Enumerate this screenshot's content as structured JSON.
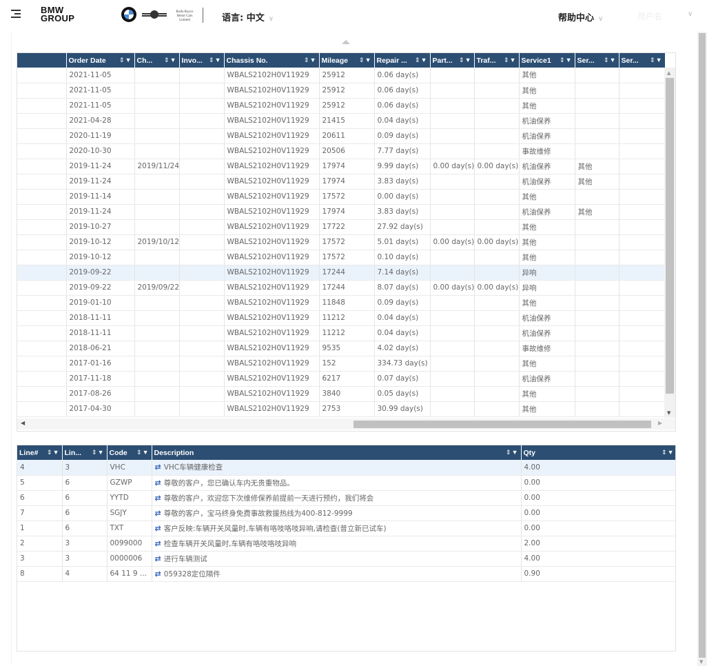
{
  "header": {
    "brand_line1": "BMW",
    "brand_line2": "GROUP",
    "rr_logo_text": "Rolls-Royce Motor Cars Limited",
    "language_label": "语言: 中文",
    "help_label": "帮助中心",
    "user_label": "用户名"
  },
  "icons": {
    "menu": "menu-icon",
    "sort": "⇕",
    "filter": "filter-icon",
    "swap": "⇄"
  },
  "colors": {
    "header_bg": "#2c4e73",
    "selected_row": "#eaf3fc",
    "swap_icon": "#2f5fb8"
  },
  "orders": {
    "columns": [
      "",
      "Order Date",
      "Ch...",
      "Invo...",
      "Chassis No.",
      "Mileage",
      "Repair ...",
      "Part...",
      "Traf...",
      "Service1",
      "Ser...",
      "Ser..."
    ],
    "rows": [
      {
        "order_date": "2021-11-05",
        "ch": "",
        "invo": "",
        "chassis": "WBALS2102H0V11929",
        "mileage": "25912",
        "repair": "0.06 day(s)",
        "part": "",
        "traf": "",
        "service1": "其他",
        "ser2": "",
        "ser3": ""
      },
      {
        "order_date": "2021-11-05",
        "ch": "",
        "invo": "",
        "chassis": "WBALS2102H0V11929",
        "mileage": "25912",
        "repair": "0.06 day(s)",
        "part": "",
        "traf": "",
        "service1": "其他",
        "ser2": "",
        "ser3": ""
      },
      {
        "order_date": "2021-11-05",
        "ch": "",
        "invo": "",
        "chassis": "WBALS2102H0V11929",
        "mileage": "25912",
        "repair": "0.06 day(s)",
        "part": "",
        "traf": "",
        "service1": "其他",
        "ser2": "",
        "ser3": ""
      },
      {
        "order_date": "2021-04-28",
        "ch": "",
        "invo": "",
        "chassis": "WBALS2102H0V11929",
        "mileage": "21415",
        "repair": "0.04 day(s)",
        "part": "",
        "traf": "",
        "service1": "机油保养",
        "ser2": "",
        "ser3": ""
      },
      {
        "order_date": "2020-11-19",
        "ch": "",
        "invo": "",
        "chassis": "WBALS2102H0V11929",
        "mileage": "20611",
        "repair": "0.09 day(s)",
        "part": "",
        "traf": "",
        "service1": "机油保养",
        "ser2": "",
        "ser3": ""
      },
      {
        "order_date": "2020-10-30",
        "ch": "",
        "invo": "",
        "chassis": "WBALS2102H0V11929",
        "mileage": "20506",
        "repair": "7.77 day(s)",
        "part": "",
        "traf": "",
        "service1": "事故维修",
        "ser2": "",
        "ser3": ""
      },
      {
        "order_date": "2019-11-24",
        "ch": "2019/11/24",
        "invo": "",
        "chassis": "WBALS2102H0V11929",
        "mileage": "17974",
        "repair": "9.99 day(s)",
        "part": "0.00 day(s)",
        "traf": "0.00 day(s)",
        "service1": "机油保养",
        "ser2": "其他",
        "ser3": ""
      },
      {
        "order_date": "2019-11-24",
        "ch": "",
        "invo": "",
        "chassis": "WBALS2102H0V11929",
        "mileage": "17974",
        "repair": "3.83 day(s)",
        "part": "",
        "traf": "",
        "service1": "机油保养",
        "ser2": "其他",
        "ser3": ""
      },
      {
        "order_date": "2019-11-14",
        "ch": "",
        "invo": "",
        "chassis": "WBALS2102H0V11929",
        "mileage": "17572",
        "repair": "0.00 day(s)",
        "part": "",
        "traf": "",
        "service1": "其他",
        "ser2": "",
        "ser3": ""
      },
      {
        "order_date": "2019-11-24",
        "ch": "",
        "invo": "",
        "chassis": "WBALS2102H0V11929",
        "mileage": "17974",
        "repair": "3.83 day(s)",
        "part": "",
        "traf": "",
        "service1": "机油保养",
        "ser2": "其他",
        "ser3": ""
      },
      {
        "order_date": "2019-10-27",
        "ch": "",
        "invo": "",
        "chassis": "WBALS2102H0V11929",
        "mileage": "17722",
        "repair": "27.92 day(s)",
        "part": "",
        "traf": "",
        "service1": "其他",
        "ser2": "",
        "ser3": ""
      },
      {
        "order_date": "2019-10-12",
        "ch": "2019/10/12",
        "invo": "",
        "chassis": "WBALS2102H0V11929",
        "mileage": "17572",
        "repair": "5.01 day(s)",
        "part": "0.00 day(s)",
        "traf": "0.00 day(s)",
        "service1": "其他",
        "ser2": "",
        "ser3": ""
      },
      {
        "order_date": "2019-10-12",
        "ch": "",
        "invo": "",
        "chassis": "WBALS2102H0V11929",
        "mileage": "17572",
        "repair": "0.10 day(s)",
        "part": "",
        "traf": "",
        "service1": "其他",
        "ser2": "",
        "ser3": ""
      },
      {
        "order_date": "2019-09-22",
        "ch": "",
        "invo": "",
        "chassis": "WBALS2102H0V11929",
        "mileage": "17244",
        "repair": "7.14 day(s)",
        "part": "",
        "traf": "",
        "service1": "异响",
        "ser2": "",
        "ser3": "",
        "selected": true
      },
      {
        "order_date": "2019-09-22",
        "ch": "2019/09/22",
        "invo": "",
        "chassis": "WBALS2102H0V11929",
        "mileage": "17244",
        "repair": "8.07 day(s)",
        "part": "0.00 day(s)",
        "traf": "0.00 day(s)",
        "service1": "异响",
        "ser2": "",
        "ser3": ""
      },
      {
        "order_date": "2019-01-10",
        "ch": "",
        "invo": "",
        "chassis": "WBALS2102H0V11929",
        "mileage": "11848",
        "repair": "0.09 day(s)",
        "part": "",
        "traf": "",
        "service1": "其他",
        "ser2": "",
        "ser3": ""
      },
      {
        "order_date": "2018-11-11",
        "ch": "",
        "invo": "",
        "chassis": "WBALS2102H0V11929",
        "mileage": "11212",
        "repair": "0.04 day(s)",
        "part": "",
        "traf": "",
        "service1": "机油保养",
        "ser2": "",
        "ser3": ""
      },
      {
        "order_date": "2018-11-11",
        "ch": "",
        "invo": "",
        "chassis": "WBALS2102H0V11929",
        "mileage": "11212",
        "repair": "0.04 day(s)",
        "part": "",
        "traf": "",
        "service1": "机油保养",
        "ser2": "",
        "ser3": ""
      },
      {
        "order_date": "2018-06-21",
        "ch": "",
        "invo": "",
        "chassis": "WBALS2102H0V11929",
        "mileage": "9535",
        "repair": "4.02 day(s)",
        "part": "",
        "traf": "",
        "service1": "事故维修",
        "ser2": "",
        "ser3": ""
      },
      {
        "order_date": "2017-01-16",
        "ch": "",
        "invo": "",
        "chassis": "WBALS2102H0V11929",
        "mileage": "152",
        "repair": "334.73 day(s)",
        "part": "",
        "traf": "",
        "service1": "其他",
        "ser2": "",
        "ser3": ""
      },
      {
        "order_date": "2017-11-18",
        "ch": "",
        "invo": "",
        "chassis": "WBALS2102H0V11929",
        "mileage": "6217",
        "repair": "0.07 day(s)",
        "part": "",
        "traf": "",
        "service1": "机油保养",
        "ser2": "",
        "ser3": ""
      },
      {
        "order_date": "2017-08-26",
        "ch": "",
        "invo": "",
        "chassis": "WBALS2102H0V11929",
        "mileage": "3840",
        "repair": "0.05 day(s)",
        "part": "",
        "traf": "",
        "service1": "其他",
        "ser2": "",
        "ser3": ""
      },
      {
        "order_date": "2017-04-30",
        "ch": "",
        "invo": "",
        "chassis": "WBALS2102H0V11929",
        "mileage": "2753",
        "repair": "30.99 day(s)",
        "part": "",
        "traf": "",
        "service1": "其他",
        "ser2": "",
        "ser3": ""
      }
    ]
  },
  "lines": {
    "columns": [
      "Line#",
      "Lin...",
      "Code",
      "Description",
      "Qty"
    ],
    "rows": [
      {
        "line": "4",
        "lin": "3",
        "code": "VHC",
        "description": "VHC车辆健康检查",
        "qty": "4.00",
        "selected": true
      },
      {
        "line": "5",
        "lin": "6",
        "code": "GZWP",
        "description": "尊敬的客户，您已确认车内无贵重物品。",
        "qty": "0.00"
      },
      {
        "line": "6",
        "lin": "6",
        "code": "YYTD",
        "description": "尊敬的客户，欢迎您下次维修保养前提前一天进行预约，我们将会",
        "qty": "0.00"
      },
      {
        "line": "7",
        "lin": "6",
        "code": "SGJY",
        "description": "尊敬的客户，宝马终身免费事故救援热线为400-812-9999",
        "qty": "0.00"
      },
      {
        "line": "1",
        "lin": "6",
        "code": "TXT",
        "description": "客户反映:车辆开关风量时,车辆有咯吱咯吱异响,请检查(普立新已试车)",
        "qty": "0.00"
      },
      {
        "line": "2",
        "lin": "3",
        "code": "0099000",
        "description": "检查车辆开关风量时,车辆有咯吱咯吱异响",
        "qty": "2.00"
      },
      {
        "line": "3",
        "lin": "3",
        "code": "0000006",
        "description": "进行车辆测试",
        "qty": "4.00"
      },
      {
        "line": "8",
        "lin": "4",
        "code": "64 11 9 ...",
        "description": "059328定位隔件",
        "qty": "0.90"
      }
    ]
  }
}
